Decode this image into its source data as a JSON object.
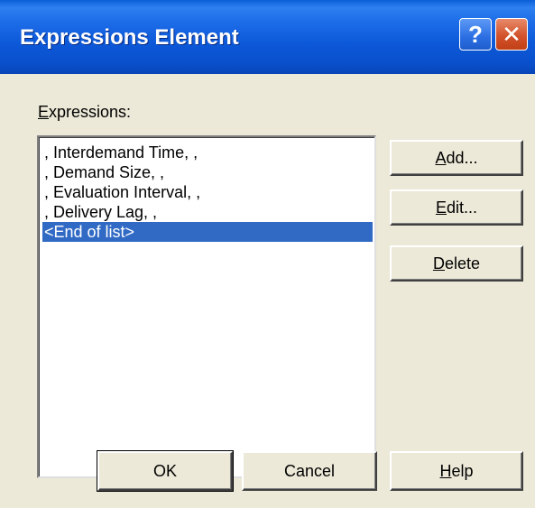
{
  "window": {
    "title": "Expressions Element",
    "help_glyph": "?",
    "close_glyph": "✕"
  },
  "expressions": {
    "label_first": "E",
    "label_rest": "xpressions:",
    "items": [
      ", Interdemand Time, ,",
      ", Demand Size, ,",
      ", Evaluation Interval, ,",
      ", Delivery Lag, ,",
      "<End of list>"
    ],
    "selected_index": 4
  },
  "buttons": {
    "add_first": "A",
    "add_rest": "dd...",
    "edit_first": "E",
    "edit_rest": "dit...",
    "delete_first": "D",
    "delete_rest": "elete",
    "ok": "OK",
    "cancel": "Cancel",
    "help_first": "H",
    "help_rest": "elp"
  },
  "colors": {
    "titlebar": "#0a50cc",
    "selection": "#316ac5",
    "dialog_face": "#ece9d8"
  },
  "icons": {
    "help": "help-icon",
    "close": "close-icon"
  }
}
